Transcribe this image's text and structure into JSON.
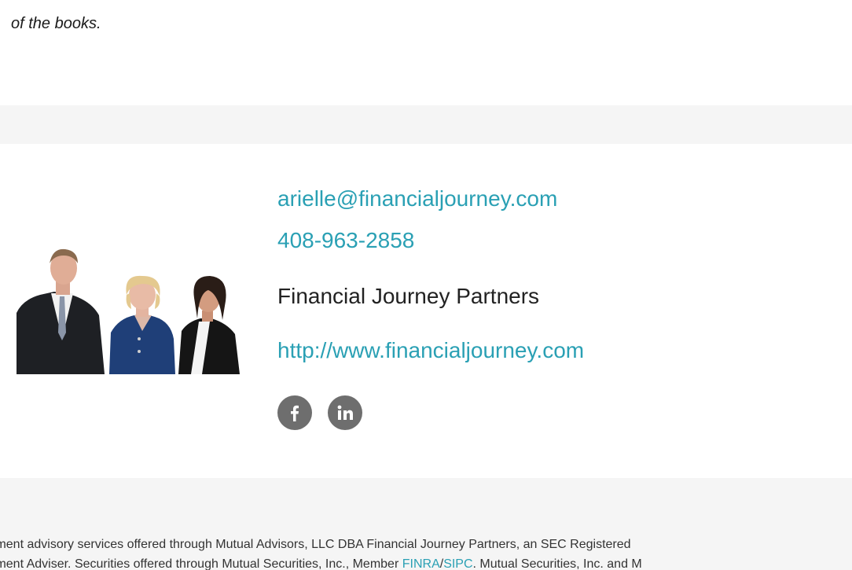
{
  "intro": {
    "text": "of the books."
  },
  "signature": {
    "email": "arielle@financialjourney.com",
    "phone": "408-963-2858",
    "company": "Financial Journey Partners",
    "website": "http://www.financialjourney.com",
    "social": [
      {
        "name": "facebook",
        "icon": "facebook-icon"
      },
      {
        "name": "linkedin",
        "icon": "linkedin-icon"
      }
    ]
  },
  "colors": {
    "link": "#2aa0b4",
    "band": "#f5f5f5",
    "social_bg": "#6e6e6e"
  },
  "disclaimer": {
    "line1": "stment advisory services offered through Mutual Advisors, LLC DBA Financial Journey Partners, an SEC Registered",
    "line2_pre": "stment Adviser. Securities offered through Mutual Securities, Inc., Member ",
    "finra": "FINRA",
    "slash": "/",
    "sipc": "SIPC",
    "line2_post": ". Mutual Securities, Inc. and M"
  }
}
